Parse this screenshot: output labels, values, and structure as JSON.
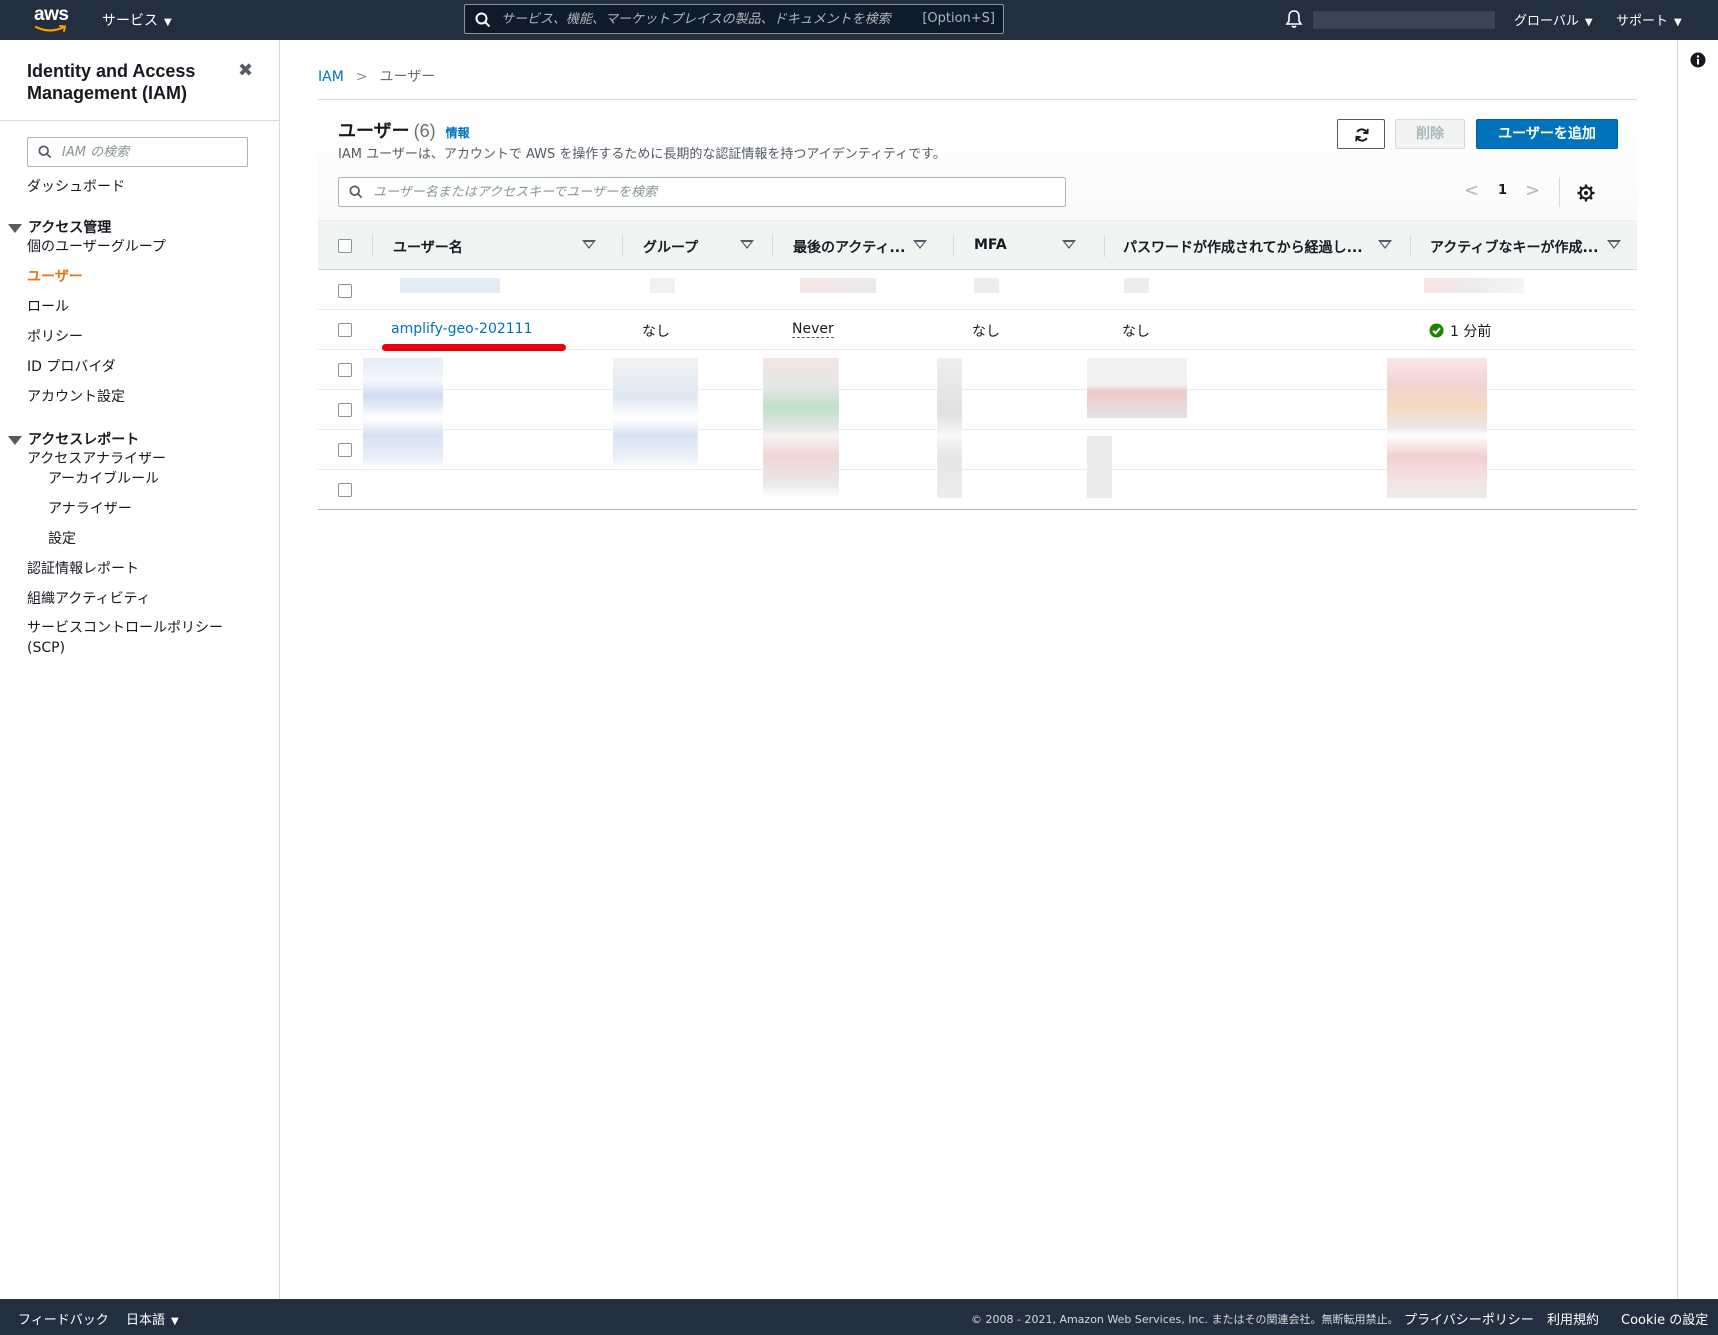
{
  "topnav": {
    "logo_text": "aws",
    "services": "サービス",
    "search_placeholder": "サービス、機能、マーケットプレイスの製品、ドキュメントを検索",
    "search_shortcut": "[Option+S]",
    "global": "グローバル",
    "support": "サポート"
  },
  "sidebar": {
    "title": "Identity and Access Management (IAM)",
    "close": "✖",
    "search_placeholder": "IAM の検索",
    "dashboard": "ダッシュボード",
    "access_management": {
      "label": "アクセス管理",
      "items": [
        "個のユーザーグループ",
        "ユーザー",
        "ロール",
        "ポリシー",
        "ID プロバイダ",
        "アカウント設定"
      ]
    },
    "access_reports": {
      "label": "アクセスレポート",
      "items": [
        "アクセスアナライザー",
        "アーカイブルール",
        "アナライザー",
        "設定",
        "認証情報レポート",
        "組織アクティビティ",
        "サービスコントロールポリシー (SCP)"
      ]
    }
  },
  "breadcrumb": {
    "root": "IAM",
    "current": "ユーザー"
  },
  "table": {
    "title": "ユーザー",
    "count": "(6)",
    "info": "情報",
    "description": "IAM ユーザーは、アカウントで AWS を操作するために長期的な認証情報を持つアイデンティティです。",
    "delete_label": "削除",
    "add_label": "ユーザーを追加",
    "search_placeholder": "ユーザー名またはアクセスキーでユーザーを検索",
    "page": "1",
    "columns": [
      "ユーザー名",
      "グループ",
      "最後のアクティ...",
      "MFA",
      "パスワードが作成されてから経過し...",
      "アクティブなキーが作成..."
    ],
    "visible_row": {
      "user_name": "amplify-geo-202111",
      "group": "なし",
      "last_activity": "Never",
      "mfa": "なし",
      "password_age": "なし",
      "active_key_age": "1 分前"
    }
  },
  "footer": {
    "feedback": "フィードバック",
    "language": "日本語",
    "copyright": "© 2008 - 2021, Amazon Web Services, Inc. またはその関連会社。無断転用禁止。",
    "privacy": "プライバシーポリシー",
    "terms": "利用規約",
    "cookie": "Cookie の設定"
  },
  "colors": {
    "nav_bg": "#232f3e",
    "link": "#0073bb",
    "active_nav": "#ec7211",
    "primary_button": "#0073bb",
    "success": "#1d8102",
    "annotation": "#e8000b"
  }
}
